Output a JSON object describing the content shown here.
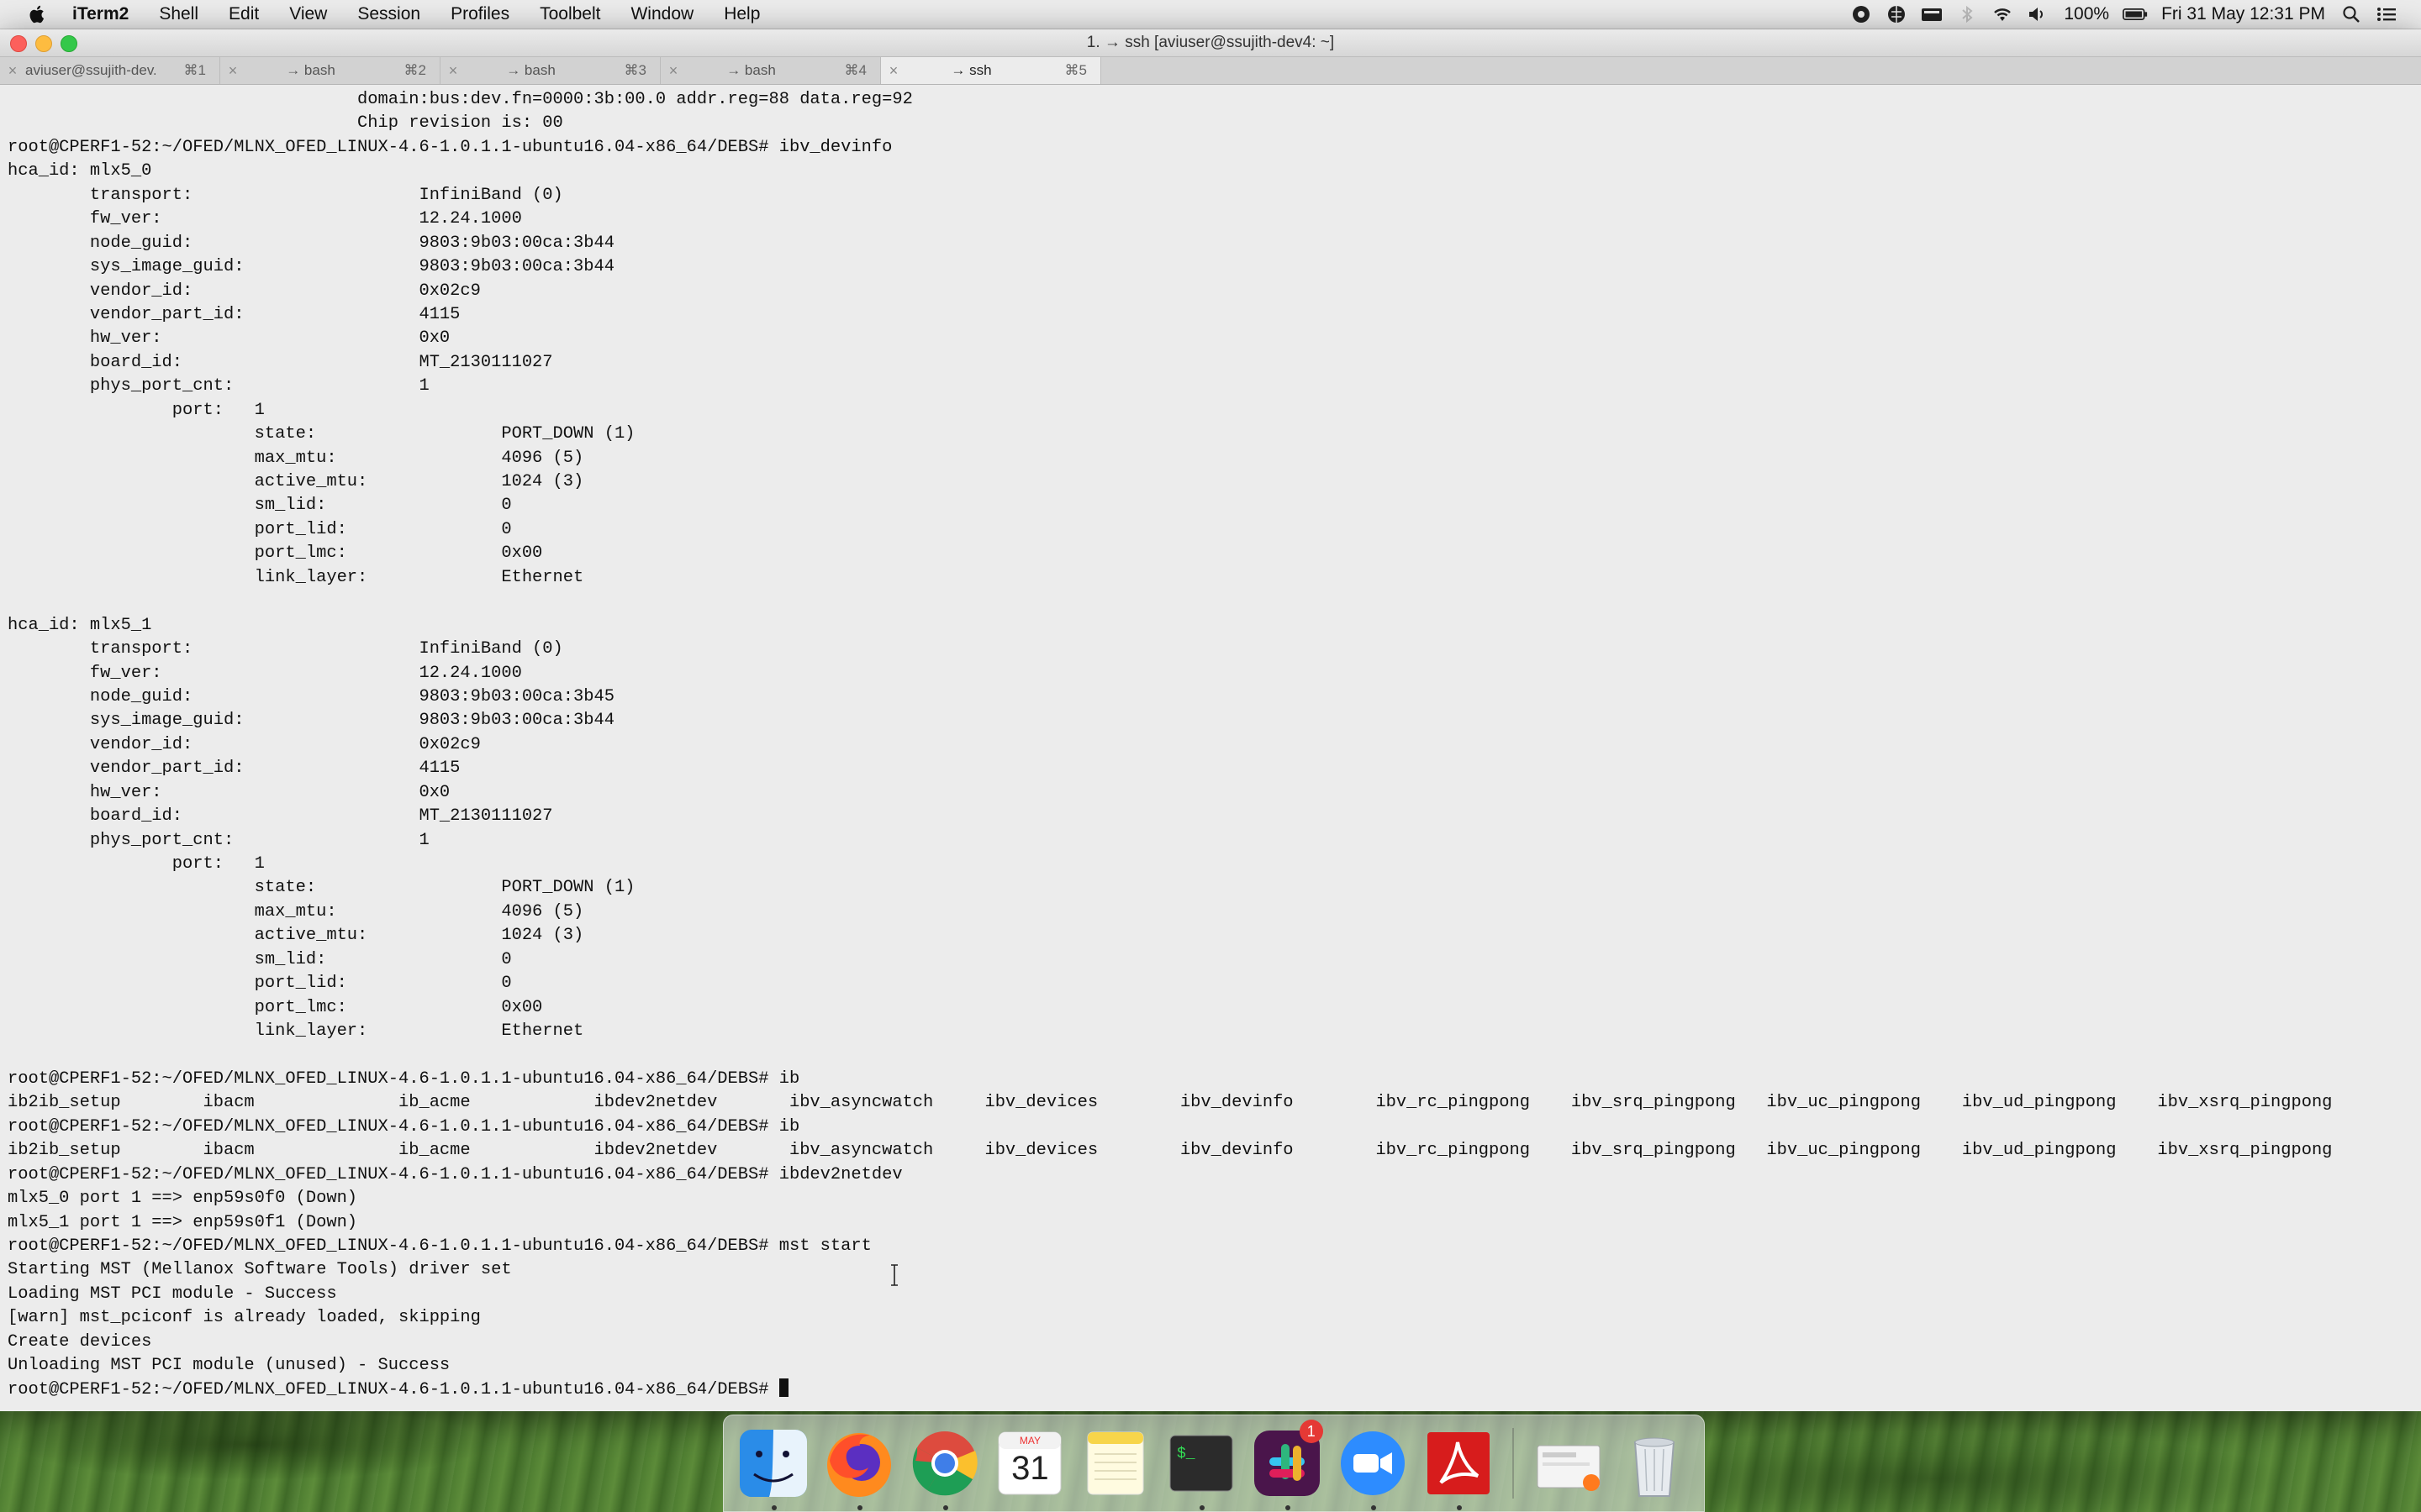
{
  "menubar": {
    "app": "iTerm2",
    "items": [
      "Shell",
      "Edit",
      "View",
      "Session",
      "Profiles",
      "Toolbelt",
      "Window",
      "Help"
    ],
    "battery": "100%",
    "clock": "Fri 31 May  12:31 PM"
  },
  "window": {
    "title": "1. → ssh [aviuser@ssujith-dev4: ~]",
    "tabs": [
      {
        "label": "aviuser@ssujith-dev...",
        "shortcut": "⌘1",
        "active": false
      },
      {
        "label": "→ bash",
        "shortcut": "⌘2",
        "active": false
      },
      {
        "label": "→ bash",
        "shortcut": "⌘3",
        "active": false
      },
      {
        "label": "→ bash",
        "shortcut": "⌘4",
        "active": false
      },
      {
        "label": "→ ssh",
        "shortcut": "⌘5",
        "active": true
      }
    ]
  },
  "terminal": {
    "lines": [
      "                                  domain:bus:dev.fn=0000:3b:00.0 addr.reg=88 data.reg=92",
      "                                  Chip revision is: 00",
      "root@CPERF1-52:~/OFED/MLNX_OFED_LINUX-4.6-1.0.1.1-ubuntu16.04-x86_64/DEBS# ibv_devinfo",
      "hca_id: mlx5_0",
      "        transport:                      InfiniBand (0)",
      "        fw_ver:                         12.24.1000",
      "        node_guid:                      9803:9b03:00ca:3b44",
      "        sys_image_guid:                 9803:9b03:00ca:3b44",
      "        vendor_id:                      0x02c9",
      "        vendor_part_id:                 4115",
      "        hw_ver:                         0x0",
      "        board_id:                       MT_2130111027",
      "        phys_port_cnt:                  1",
      "                port:   1",
      "                        state:                  PORT_DOWN (1)",
      "                        max_mtu:                4096 (5)",
      "                        active_mtu:             1024 (3)",
      "                        sm_lid:                 0",
      "                        port_lid:               0",
      "                        port_lmc:               0x00",
      "                        link_layer:             Ethernet",
      "",
      "hca_id: mlx5_1",
      "        transport:                      InfiniBand (0)",
      "        fw_ver:                         12.24.1000",
      "        node_guid:                      9803:9b03:00ca:3b45",
      "        sys_image_guid:                 9803:9b03:00ca:3b44",
      "        vendor_id:                      0x02c9",
      "        vendor_part_id:                 4115",
      "        hw_ver:                         0x0",
      "        board_id:                       MT_2130111027",
      "        phys_port_cnt:                  1",
      "                port:   1",
      "                        state:                  PORT_DOWN (1)",
      "                        max_mtu:                4096 (5)",
      "                        active_mtu:             1024 (3)",
      "                        sm_lid:                 0",
      "                        port_lid:               0",
      "                        port_lmc:               0x00",
      "                        link_layer:             Ethernet",
      "",
      "root@CPERF1-52:~/OFED/MLNX_OFED_LINUX-4.6-1.0.1.1-ubuntu16.04-x86_64/DEBS# ib",
      "ib2ib_setup        ibacm              ib_acme            ibdev2netdev       ibv_asyncwatch     ibv_devices        ibv_devinfo        ibv_rc_pingpong    ibv_srq_pingpong   ibv_uc_pingpong    ibv_ud_pingpong    ibv_xsrq_pingpong",
      "root@CPERF1-52:~/OFED/MLNX_OFED_LINUX-4.6-1.0.1.1-ubuntu16.04-x86_64/DEBS# ib",
      "ib2ib_setup        ibacm              ib_acme            ibdev2netdev       ibv_asyncwatch     ibv_devices        ibv_devinfo        ibv_rc_pingpong    ibv_srq_pingpong   ibv_uc_pingpong    ibv_ud_pingpong    ibv_xsrq_pingpong",
      "root@CPERF1-52:~/OFED/MLNX_OFED_LINUX-4.6-1.0.1.1-ubuntu16.04-x86_64/DEBS# ibdev2netdev",
      "mlx5_0 port 1 ==> enp59s0f0 (Down)",
      "mlx5_1 port 1 ==> enp59s0f1 (Down)",
      "root@CPERF1-52:~/OFED/MLNX_OFED_LINUX-4.6-1.0.1.1-ubuntu16.04-x86_64/DEBS# mst start",
      "Starting MST (Mellanox Software Tools) driver set",
      "Loading MST PCI module - Success",
      "[warn] mst_pciconf is already loaded, skipping",
      "Create devices",
      "Unloading MST PCI module (unused) - Success"
    ],
    "prompt": "root@CPERF1-52:~/OFED/MLNX_OFED_LINUX-4.6-1.0.1.1-ubuntu16.04-x86_64/DEBS# "
  },
  "dock": {
    "apps": [
      {
        "name": "Finder",
        "icon": "finder-icon"
      },
      {
        "name": "Firefox",
        "icon": "firefox-icon"
      },
      {
        "name": "Chrome",
        "icon": "chrome-icon"
      },
      {
        "name": "Calendar",
        "icon": "calendar-icon",
        "month": "MAY",
        "day": "31"
      },
      {
        "name": "Notes",
        "icon": "notes-icon"
      },
      {
        "name": "Terminal",
        "icon": "terminal-icon"
      },
      {
        "name": "Slack",
        "icon": "slack-icon",
        "badge": "1"
      },
      {
        "name": "Zoom",
        "icon": "zoom-icon"
      },
      {
        "name": "Acrobat",
        "icon": "acrobat-icon"
      },
      {
        "name": "Downloads",
        "icon": "downloads-stack-icon"
      },
      {
        "name": "Trash",
        "icon": "trash-icon"
      }
    ]
  },
  "colors": {
    "terminal_bg": "#ececec",
    "terminal_fg": "#111111",
    "close": "#fc605c",
    "minimize": "#fdbc40",
    "maximize": "#34c84a"
  }
}
